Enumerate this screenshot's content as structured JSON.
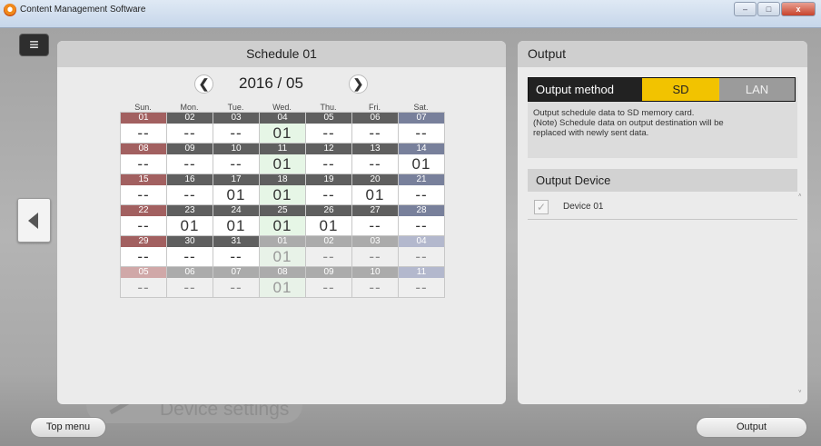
{
  "window": {
    "title": "Content Management Software",
    "minimize": "–",
    "maximize": "□",
    "close": "x"
  },
  "background": {
    "device_settings": "Device settings"
  },
  "footer": {
    "top_menu": "Top menu",
    "output": "Output"
  },
  "schedule": {
    "title": "Schedule 01",
    "month": "2016 / 05",
    "prev": "❮",
    "next": "❯",
    "day_names": [
      "Sun.",
      "Mon.",
      "Tue.",
      "Wed.",
      "Thu.",
      "Fri.",
      "Sat."
    ],
    "weeks": [
      [
        {
          "d": "01",
          "v": "--"
        },
        {
          "d": "02",
          "v": "--"
        },
        {
          "d": "03",
          "v": "--"
        },
        {
          "d": "04",
          "v": "01"
        },
        {
          "d": "05",
          "v": "--"
        },
        {
          "d": "06",
          "v": "--"
        },
        {
          "d": "07",
          "v": "--"
        }
      ],
      [
        {
          "d": "08",
          "v": "--"
        },
        {
          "d": "09",
          "v": "--"
        },
        {
          "d": "10",
          "v": "--"
        },
        {
          "d": "11",
          "v": "01"
        },
        {
          "d": "12",
          "v": "--"
        },
        {
          "d": "13",
          "v": "--"
        },
        {
          "d": "14",
          "v": "01"
        }
      ],
      [
        {
          "d": "15",
          "v": "--"
        },
        {
          "d": "16",
          "v": "--"
        },
        {
          "d": "17",
          "v": "01"
        },
        {
          "d": "18",
          "v": "01"
        },
        {
          "d": "19",
          "v": "--"
        },
        {
          "d": "20",
          "v": "01"
        },
        {
          "d": "21",
          "v": "--"
        }
      ],
      [
        {
          "d": "22",
          "v": "--"
        },
        {
          "d": "23",
          "v": "01"
        },
        {
          "d": "24",
          "v": "01"
        },
        {
          "d": "25",
          "v": "01"
        },
        {
          "d": "26",
          "v": "01"
        },
        {
          "d": "27",
          "v": "--"
        },
        {
          "d": "28",
          "v": "--"
        }
      ],
      [
        {
          "d": "29",
          "v": "--"
        },
        {
          "d": "30",
          "v": "--"
        },
        {
          "d": "31",
          "v": "--"
        },
        {
          "d": "01",
          "v": "01",
          "other": true
        },
        {
          "d": "02",
          "v": "--",
          "other": true
        },
        {
          "d": "03",
          "v": "--",
          "other": true
        },
        {
          "d": "04",
          "v": "--",
          "other": true
        }
      ],
      [
        {
          "d": "05",
          "v": "--",
          "other": true
        },
        {
          "d": "06",
          "v": "--",
          "other": true
        },
        {
          "d": "07",
          "v": "--",
          "other": true
        },
        {
          "d": "08",
          "v": "01",
          "other": true
        },
        {
          "d": "09",
          "v": "--",
          "other": true
        },
        {
          "d": "10",
          "v": "--",
          "other": true
        },
        {
          "d": "11",
          "v": "--",
          "other": true
        }
      ]
    ]
  },
  "output": {
    "title": "Output",
    "method_label": "Output method",
    "method_sd": "SD",
    "method_lan": "LAN",
    "selected_method": "SD",
    "note_lines": [
      "Output schedule data to SD memory card.",
      "(Note) Schedule data on output destination will be",
      "replaced with newly sent data."
    ],
    "device_header": "Output Device",
    "devices": [
      {
        "name": "Device 01",
        "checked": true
      }
    ],
    "scroll_up": "˄",
    "scroll_down": "˅"
  },
  "colors": {
    "sd_selected": "#f2c300",
    "sunday_header": "#a26060",
    "saturday_header": "#78809b",
    "wednesday_highlight": "#e6f6e6"
  }
}
